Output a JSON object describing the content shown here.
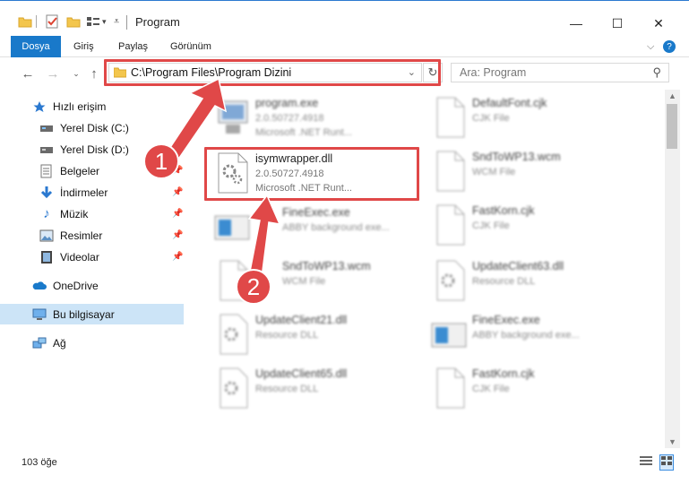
{
  "window": {
    "title": "Program",
    "minimize": "—",
    "maximize": "☐",
    "close": "✕"
  },
  "ribbon": {
    "tabs": [
      "Dosya",
      "Giriş",
      "Paylaş",
      "Görünüm"
    ]
  },
  "address": {
    "path": "C:\\Program Files\\Program Dizini",
    "search_placeholder": "Ara: Program"
  },
  "sidebar": {
    "items": [
      {
        "label": "Hızlı erişim",
        "icon": "star-icon"
      },
      {
        "label": "Yerel Disk (C:)",
        "icon": "drive-icon"
      },
      {
        "label": "Yerel Disk (D:)",
        "icon": "drive-icon"
      },
      {
        "label": "Belgeler",
        "icon": "documents-icon"
      },
      {
        "label": "İndirmeler",
        "icon": "download-icon"
      },
      {
        "label": "Müzik",
        "icon": "music-icon"
      },
      {
        "label": "Resimler",
        "icon": "pictures-icon"
      },
      {
        "label": "Videolar",
        "icon": "video-icon"
      },
      {
        "label": "OneDrive",
        "icon": "cloud-icon"
      },
      {
        "label": "Bu bilgisayar",
        "icon": "computer-icon"
      },
      {
        "label": "Ağ",
        "icon": "network-icon"
      }
    ]
  },
  "files": [
    {
      "name": "program.exe",
      "line1": "2.0.50727.4918",
      "line2": "Microsoft .NET Runt..."
    },
    {
      "name": "DefaultFont.cjk",
      "line1": "CJK File",
      "line2": ""
    },
    {
      "name": "isymwrapper.dll",
      "line1": "2.0.50727.4918",
      "line2": "Microsoft .NET Runt..."
    },
    {
      "name": "SndToWP13.wcm",
      "line1": "WCM File",
      "line2": ""
    },
    {
      "name": "FineExec.exe",
      "line1": "ABBY background exe...",
      "line2": ""
    },
    {
      "name": "FastKorn.cjk",
      "line1": "CJK File",
      "line2": ""
    },
    {
      "name": "SndToWP13.wcm",
      "line1": "WCM File",
      "line2": ""
    },
    {
      "name": "UpdateClient63.dll",
      "line1": "Resource DLL",
      "line2": ""
    },
    {
      "name": "UpdateClient21.dll",
      "line1": "Resource DLL",
      "line2": ""
    },
    {
      "name": "FineExec.exe",
      "line1": "ABBY background exe...",
      "line2": ""
    },
    {
      "name": "UpdateClient65.dll",
      "line1": "Resource DLL",
      "line2": ""
    },
    {
      "name": "FastKorn.cjk",
      "line1": "CJK File",
      "line2": ""
    }
  ],
  "status": {
    "count": "103 öğe"
  },
  "callouts": [
    "1",
    "2"
  ],
  "colors": {
    "accent": "#1979ca",
    "highlight": "#e04848",
    "selected": "#cce4f7"
  }
}
